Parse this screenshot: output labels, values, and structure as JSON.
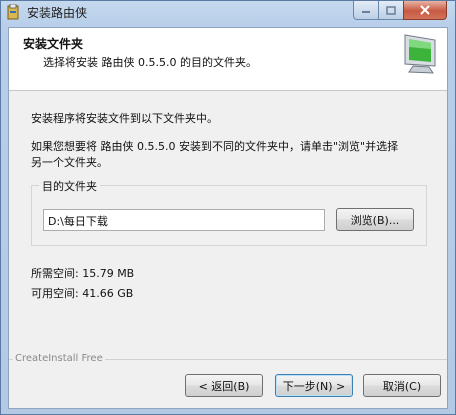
{
  "window": {
    "title": "安装路由侠",
    "icon": "installer-icon",
    "controls": {
      "minimize": "minimize-icon",
      "maximize": "maximize-icon",
      "close": "close-icon"
    }
  },
  "header": {
    "title": "安装文件夹",
    "subtitle": "选择将安装 路由侠 0.5.5.0 的目的文件夹。",
    "icon": "computer-monitor-icon"
  },
  "body": {
    "line1": "安装程序将安装文件到以下文件夹中。",
    "line2": "如果您想要将 路由侠 0.5.5.0 安装到不同的文件夹中，请单击\"浏览\"并选择",
    "line3": "另一个文件夹。"
  },
  "destination": {
    "group_label": "目的文件夹",
    "path": "D:\\每日下载",
    "browse_label": "浏览(B)..."
  },
  "space": {
    "required": "所需空间: 15.79 MB",
    "available": "可用空间: 41.66 GB"
  },
  "footer": {
    "brand": "CreateInstall Free",
    "back_label": "< 返回(B)",
    "next_label": "下一步(N) >",
    "cancel_label": "取消(C)"
  },
  "colors": {
    "frame": "#b7cde8",
    "close_button": "#c85a43",
    "monitor_screen": "#3cb43c"
  }
}
